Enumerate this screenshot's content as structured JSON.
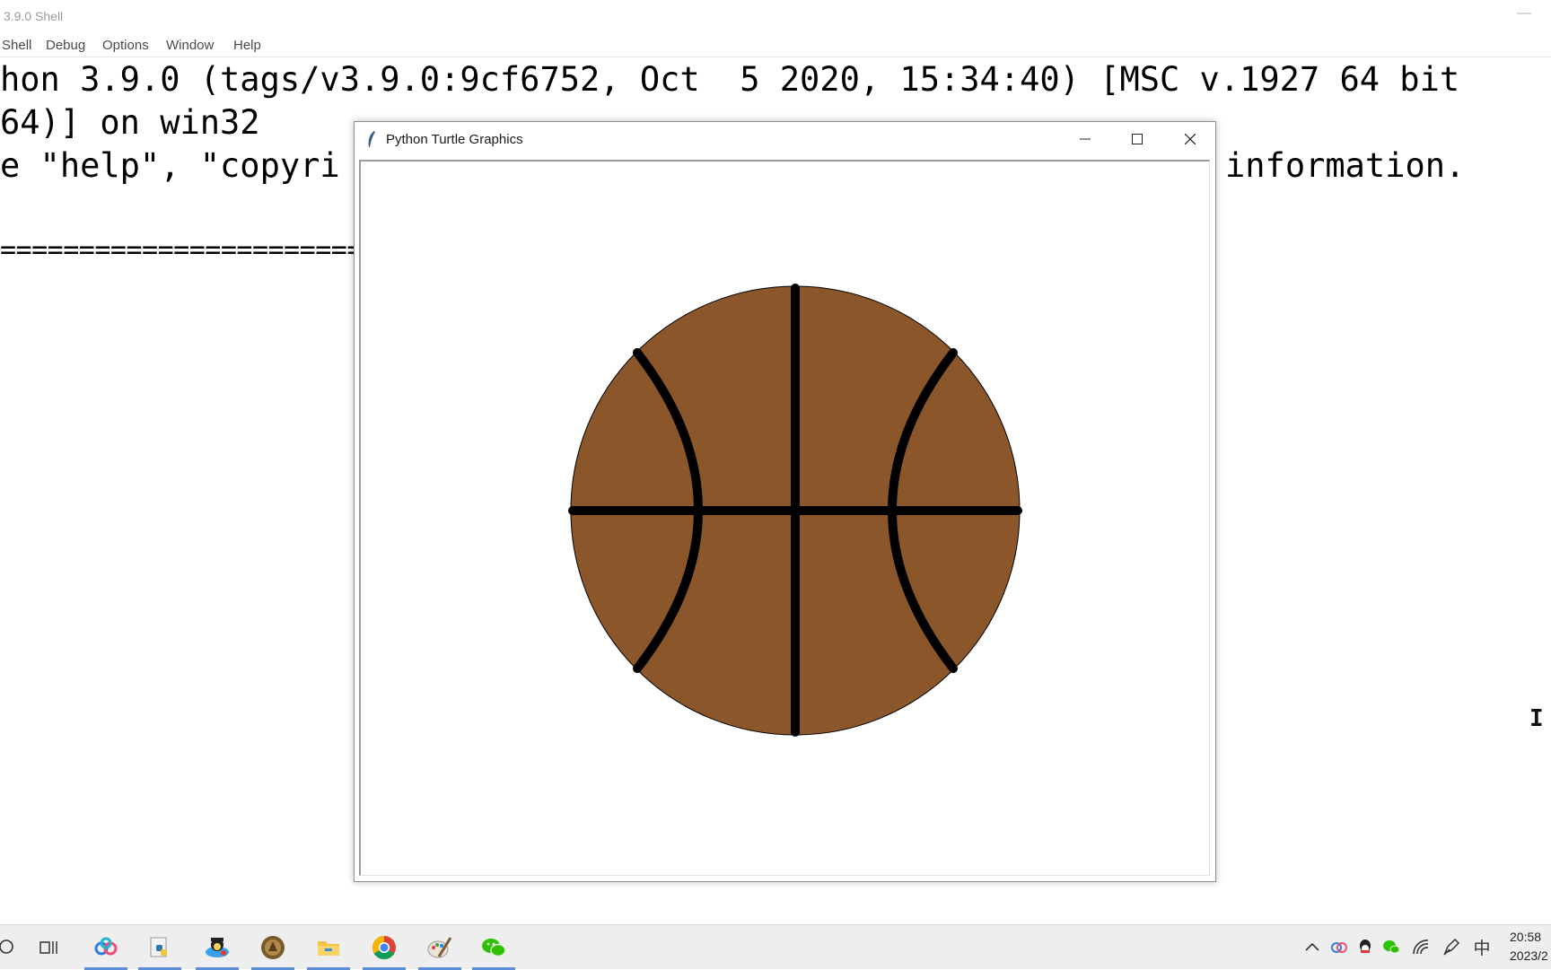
{
  "shell": {
    "title": "3.9.0 Shell",
    "menu": [
      "Shell",
      "Debug",
      "Options",
      "Window",
      "Help"
    ],
    "console_lines": [
      "hon 3.9.0 (tags/v3.9.0:9cf6752, Oct  5 2020, 15:34:40) [MSC v.1927 64 bit",
      "64)] on win32",
      "e \"help\", \"copyri",
      "information.",
      "============================================================================="
    ]
  },
  "turtle_window": {
    "title": "Python Turtle Graphics",
    "buttons": {
      "minimize": "minimize-icon",
      "maximize": "maximize-icon",
      "close": "close-icon"
    },
    "ball_color": "#8b572a",
    "line_color": "#000000"
  },
  "taskbar": {
    "apps": [
      "search-icon",
      "task-view-icon",
      "baidu-netdisk-icon",
      "python-idle-icon",
      "qq-game-icon",
      "game-icon",
      "file-explorer-icon",
      "chrome-icon",
      "paint-icon",
      "wechat-icon"
    ],
    "tray": [
      "chevron-up-icon",
      "cloud-icon",
      "qq-icon",
      "wechat-tray-icon",
      "wifi-icon",
      "pen-icon"
    ],
    "ime": "中",
    "time": "20:58",
    "date": "2023/2"
  }
}
